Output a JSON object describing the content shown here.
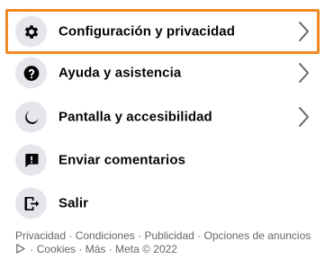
{
  "menu": {
    "items": [
      {
        "label": "Configuración y privacidad",
        "icon": "gear-icon",
        "has_chevron": true,
        "highlighted": true
      },
      {
        "label": "Ayuda y asistencia",
        "icon": "question-icon",
        "has_chevron": true
      },
      {
        "label": "Pantalla y accesibilidad",
        "icon": "moon-icon",
        "has_chevron": true
      },
      {
        "label": "Enviar comentarios",
        "icon": "feedback-icon",
        "has_chevron": false
      },
      {
        "label": "Salir",
        "icon": "logout-icon",
        "has_chevron": false
      }
    ]
  },
  "footer": {
    "links": {
      "privacy": "Privacidad",
      "terms": "Condiciones",
      "advertising": "Publicidad",
      "ad_choices": "Opciones de anuncios",
      "cookies": "Cookies",
      "more": "Más"
    },
    "copyright": "Meta © 2022",
    "separator": "·"
  },
  "colors": {
    "highlight_border": "#f08a24",
    "icon_bg": "#e4e6eb",
    "text": "#050505",
    "secondary_text": "#65676b"
  }
}
